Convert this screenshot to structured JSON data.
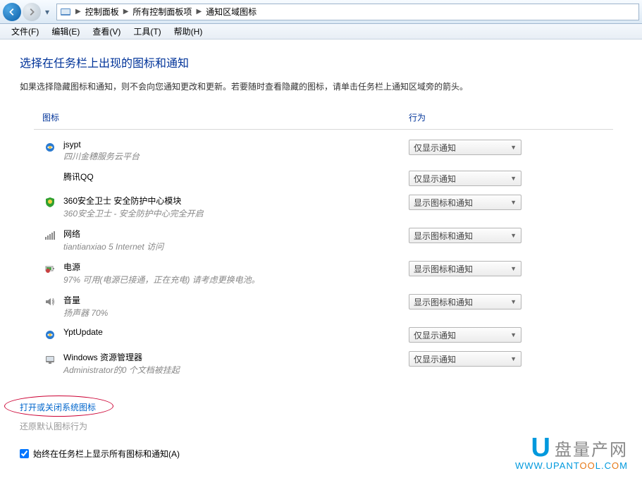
{
  "nav": {
    "breadcrumbs": [
      "控制面板",
      "所有控制面板项",
      "通知区域图标"
    ]
  },
  "menu": {
    "file": "文件(F)",
    "edit": "编辑(E)",
    "view": "查看(V)",
    "tools": "工具(T)",
    "help": "帮助(H)"
  },
  "page": {
    "title": "选择在任务栏上出现的图标和通知",
    "desc": "如果选择隐藏图标和通知，则不会向您通知更改和更新。若要随时查看隐藏的图标，请单击任务栏上通知区域旁的箭头。"
  },
  "columns": {
    "icon": "图标",
    "action": "行为"
  },
  "options": {
    "notify_only": "仅显示通知",
    "show_both": "显示图标和通知"
  },
  "rows": [
    {
      "icon": "ie",
      "title": "jsypt",
      "sub": "四川金穗服务云平台",
      "behavior": "notify_only"
    },
    {
      "icon": "blank",
      "title": "腾讯QQ",
      "sub": "",
      "behavior": "notify_only"
    },
    {
      "icon": "shield",
      "title": "360安全卫士 安全防护中心模块",
      "sub": "360安全卫士 - 安全防护中心完全开启",
      "behavior": "show_both"
    },
    {
      "icon": "network",
      "title": "网络",
      "sub": "tiantianxiao 5 Internet 访问",
      "behavior": "show_both"
    },
    {
      "icon": "power",
      "title": "电源",
      "sub": "97% 可用(电源已接通，正在充电)  请考虑更换电池。",
      "behavior": "show_both"
    },
    {
      "icon": "volume",
      "title": "音量",
      "sub": "扬声器 70%",
      "behavior": "show_both"
    },
    {
      "icon": "ie",
      "title": "YptUpdate",
      "sub": "",
      "behavior": "notify_only"
    },
    {
      "icon": "explorer",
      "title": "Windows 资源管理器",
      "sub": "Administrator的0 个文档被挂起",
      "behavior": "notify_only"
    }
  ],
  "links": {
    "toggle_system_icons": "打开或关闭系统图标",
    "restore_default": "还原默认图标行为"
  },
  "checkbox": {
    "label": "始终在任务栏上显示所有图标和通知(A)",
    "checked": true
  },
  "watermark": {
    "brand": "盘量产网",
    "url_prefix": "WWW.UPANT",
    "url_o1": "O",
    "url_o2": "O",
    "url_suffix": "L.C",
    "url_end": "M"
  }
}
